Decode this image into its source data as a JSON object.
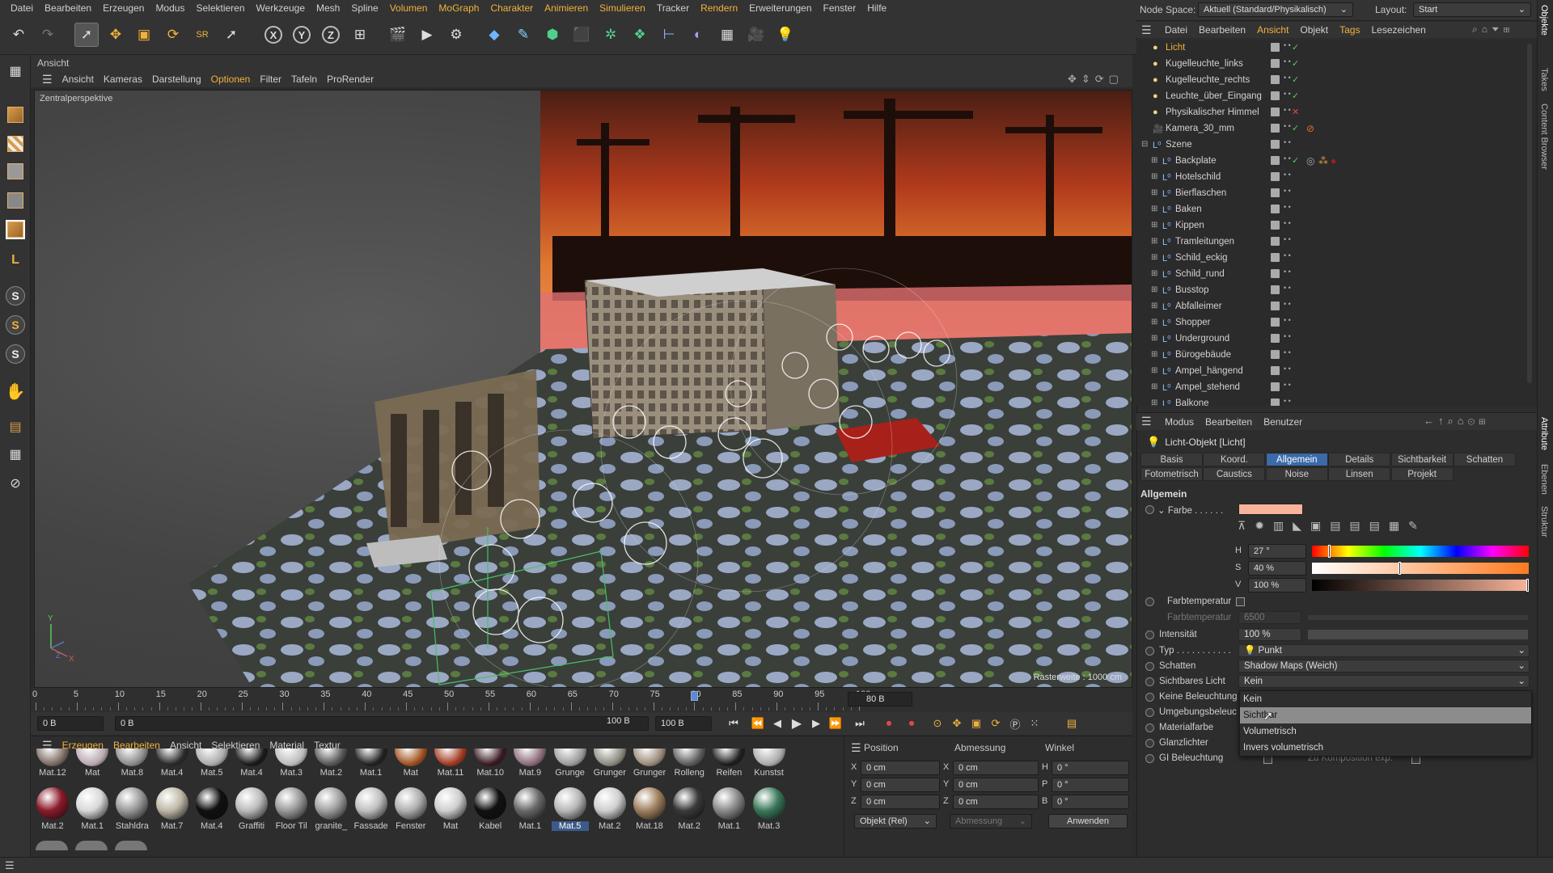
{
  "menubar": {
    "items": [
      "Datei",
      "Bearbeiten",
      "Erzeugen",
      "Modus",
      "Selektieren",
      "Werkzeuge",
      "Mesh",
      "Spline",
      "Volumen",
      "MoGraph",
      "Charakter",
      "Animieren",
      "Simulieren",
      "Tracker",
      "Rendern",
      "Erweiterungen",
      "Fenster",
      "Hilfe"
    ]
  },
  "topright": {
    "node_space_label": "Node Space:",
    "node_space_value": "Aktuell (Standard/Physikalisch)",
    "layout_label": "Layout:",
    "layout_value": "Start"
  },
  "viewport": {
    "panel_title": "Ansicht",
    "menu": [
      "Ansicht",
      "Kameras",
      "Darstellung",
      "Optionen",
      "Filter",
      "Tafeln",
      "ProRender"
    ],
    "camera_label": "Zentralperspektive",
    "grid_info": "Rasterweite : 1000 cm",
    "axis_y": "Y",
    "axis_z": "Z",
    "axis_x": "X"
  },
  "timeline": {
    "ticks": [
      "0",
      "5",
      "10",
      "15",
      "20",
      "25",
      "30",
      "35",
      "40",
      "45",
      "50",
      "55",
      "60",
      "65",
      "70",
      "75",
      "80",
      "85",
      "90",
      "95",
      "100"
    ],
    "current_frame": "80 B",
    "start_field": "0 B",
    "preview_start": "0 B",
    "preview_end": "100 B",
    "end_field": "100 B",
    "playhead_fraction": 0.8
  },
  "materials": {
    "menu": [
      "Erzeugen",
      "Bearbeiten",
      "Ansicht",
      "Selektieren",
      "Material",
      "Textur"
    ],
    "row1": [
      "Mat.12",
      "Mat",
      "Mat.8",
      "Mat.4",
      "Mat.5",
      "Mat.4",
      "Mat.3",
      "Mat.2",
      "Mat.1",
      "Mat",
      "Mat.11",
      "Mat.10",
      "Mat.9",
      "Grunge",
      "Grunger",
      "Grunger",
      "Rolleng",
      "Reifen",
      "Kunstst"
    ],
    "row2": [
      "Mat.2",
      "Mat.1",
      "Stahldra",
      "Mat.7",
      "Mat.4",
      "Graffiti",
      "Floor Til",
      "granite_",
      "Fassade",
      "Fenster",
      "Mat",
      "Kabel",
      "Mat.1",
      "Mat.5",
      "Mat.2",
      "Mat.18",
      "Mat.2",
      "Mat.1",
      "Mat.3"
    ],
    "selected": "Mat.5"
  },
  "coords": {
    "headers": [
      "Position",
      "Abmessung",
      "Winkel"
    ],
    "rows": [
      {
        "a": "X",
        "av": "0 cm",
        "b": "X",
        "bv": "0 cm",
        "c": "H",
        "cv": "0 °"
      },
      {
        "a": "Y",
        "av": "0 cm",
        "b": "Y",
        "bv": "0 cm",
        "c": "P",
        "cv": "0 °"
      },
      {
        "a": "Z",
        "av": "0 cm",
        "b": "Z",
        "bv": "0 cm",
        "c": "B",
        "cv": "0 °"
      }
    ],
    "mode": "Objekt (Rel)",
    "size_mode": "Abmessung",
    "apply": "Anwenden"
  },
  "object_manager": {
    "menu": [
      "Datei",
      "Bearbeiten",
      "Ansicht",
      "Objekt",
      "Tags",
      "Lesezeichen"
    ],
    "objects": [
      {
        "name": "Licht",
        "level": 0,
        "active": true
      },
      {
        "name": "Kugelleuchte_links",
        "level": 0
      },
      {
        "name": "Kugelleuchte_rechts",
        "level": 0
      },
      {
        "name": "Leuchte_über_Eingang",
        "level": 0
      },
      {
        "name": "Physikalischer Himmel",
        "level": 0
      },
      {
        "name": "Kamera_30_mm",
        "level": 0
      },
      {
        "name": "Szene",
        "level": 0
      },
      {
        "name": "Backplate",
        "level": 1
      },
      {
        "name": "Hotelschild",
        "level": 1
      },
      {
        "name": "Bierflaschen",
        "level": 1
      },
      {
        "name": "Baken",
        "level": 1
      },
      {
        "name": "Kippen",
        "level": 1
      },
      {
        "name": "Tramleitungen",
        "level": 1
      },
      {
        "name": "Schild_eckig",
        "level": 1
      },
      {
        "name": "Schild_rund",
        "level": 1
      },
      {
        "name": "Busstop",
        "level": 1
      },
      {
        "name": "Abfalleimer",
        "level": 1
      },
      {
        "name": "Shopper",
        "level": 1
      },
      {
        "name": "Underground",
        "level": 1
      },
      {
        "name": "Bürogebäude",
        "level": 1
      },
      {
        "name": "Ampel_hängend",
        "level": 1
      },
      {
        "name": "Ampel_stehend",
        "level": 1
      },
      {
        "name": "Balkone",
        "level": 1
      }
    ]
  },
  "attributes": {
    "menu": [
      "Modus",
      "Bearbeiten",
      "Benutzer"
    ],
    "title": "Licht-Objekt [Licht]",
    "tabs_row1": [
      "Basis",
      "Koord.",
      "Allgemein",
      "Details",
      "Sichtbarkeit",
      "Schatten"
    ],
    "tabs_row2": [
      "Fotometrisch",
      "Caustics",
      "Noise",
      "Linsen",
      "Projekt"
    ],
    "active_tab": "Allgemein",
    "section": "Allgemein",
    "farbe_label": "Farbe . . . . . .",
    "color_swatch": "#f7b49a",
    "h_label": "H",
    "h_value": "27 °",
    "h_fraction": 0.075,
    "s_label": "S",
    "s_value": "40 %",
    "s_fraction": 0.4,
    "v_label": "V",
    "v_value": "100 %",
    "farbtemp_toggle_label": "Farbtemperatur",
    "farbtemp_label": "Farbtemperatur",
    "farbtemp_value": "6500",
    "intensitaet_label": "Intensität",
    "intensitaet_value": "100 %",
    "typ_label": "Typ . . . . . . . . . . .",
    "typ_value": "Punkt",
    "schatten_label": "Schatten",
    "schatten_value": "Shadow Maps (Weich)",
    "sichtbar_label": "Sichtbares Licht",
    "sichtbar_value": "Kein",
    "keine_beleuchtung": "Keine Beleuchtung",
    "umgebung": "Umgebungsbeleuc",
    "materialfarbe": "Materialfarbe",
    "glanzlichter": "Glanzlichter",
    "gi": "GI Beleuchtung",
    "zu_komposition": "Zu Komposition exp."
  },
  "dropdown": {
    "options": [
      "Kein",
      "Sichtbar",
      "Volumetrisch",
      "Invers volumetrisch"
    ],
    "highlighted": "Sichtbar"
  },
  "side_tabs": [
    "Objekte",
    "Takes",
    "Content Browser",
    "Attribute",
    "Ebenen",
    "Struktur"
  ],
  "colors": {
    "accent": "#f0b23c",
    "selection": "#3a6aa8"
  }
}
